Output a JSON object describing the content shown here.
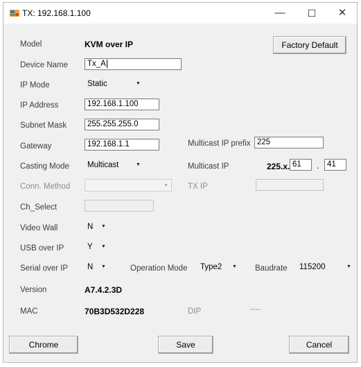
{
  "window": {
    "title": "TX: 192.168.1.100",
    "minimize": "—",
    "maximize": "☐",
    "close": "✕",
    "icon": "app-window-icon"
  },
  "fields": {
    "model": {
      "label": "Model",
      "value": "KVM over IP"
    },
    "device_name": {
      "label": "Device Name",
      "value": "Tx_A"
    },
    "ip_mode": {
      "label": "IP Mode",
      "value": "Static"
    },
    "ip_address": {
      "label": "IP Address",
      "value": "192.168.1.100"
    },
    "subnet_mask": {
      "label": "Subnet Mask",
      "value": "255.255.255.0"
    },
    "gateway": {
      "label": "Gateway",
      "value": "192.168.1.1"
    },
    "multicast_ip_prefix": {
      "label": "Multicast IP prefix",
      "value": "225"
    },
    "casting_mode": {
      "label": "Casting Mode",
      "value": "Multicast"
    },
    "multicast_ip": {
      "label": "Multicast IP",
      "prefix": "225.x.",
      "octet3": "61",
      "dot": ".",
      "octet4": "41"
    },
    "conn_method": {
      "label": "Conn. Method",
      "value": ""
    },
    "tx_ip": {
      "label": "TX IP",
      "value": ""
    },
    "ch_select": {
      "label": "Ch_Select",
      "value": ""
    },
    "video_wall": {
      "label": "Video Wall",
      "value": "N"
    },
    "usb_over_ip": {
      "label": "USB over IP",
      "value": "Y"
    },
    "serial_over_ip": {
      "label": "Serial over IP",
      "value": "N"
    },
    "operation_mode": {
      "label": "Operation Mode",
      "value": "Type2"
    },
    "baudrate": {
      "label": "Baudrate",
      "value": "115200"
    },
    "version": {
      "label": "Version",
      "value": "A7.4.2.3D"
    },
    "mac": {
      "label": "MAC",
      "value": "70B3D532D228"
    },
    "dip": {
      "label": "DIP",
      "value": "----"
    }
  },
  "buttons": {
    "factory_default": "Factory Default",
    "chrome": "Chrome",
    "save": "Save",
    "cancel": "Cancel"
  },
  "dropdown_arrow": "▼"
}
